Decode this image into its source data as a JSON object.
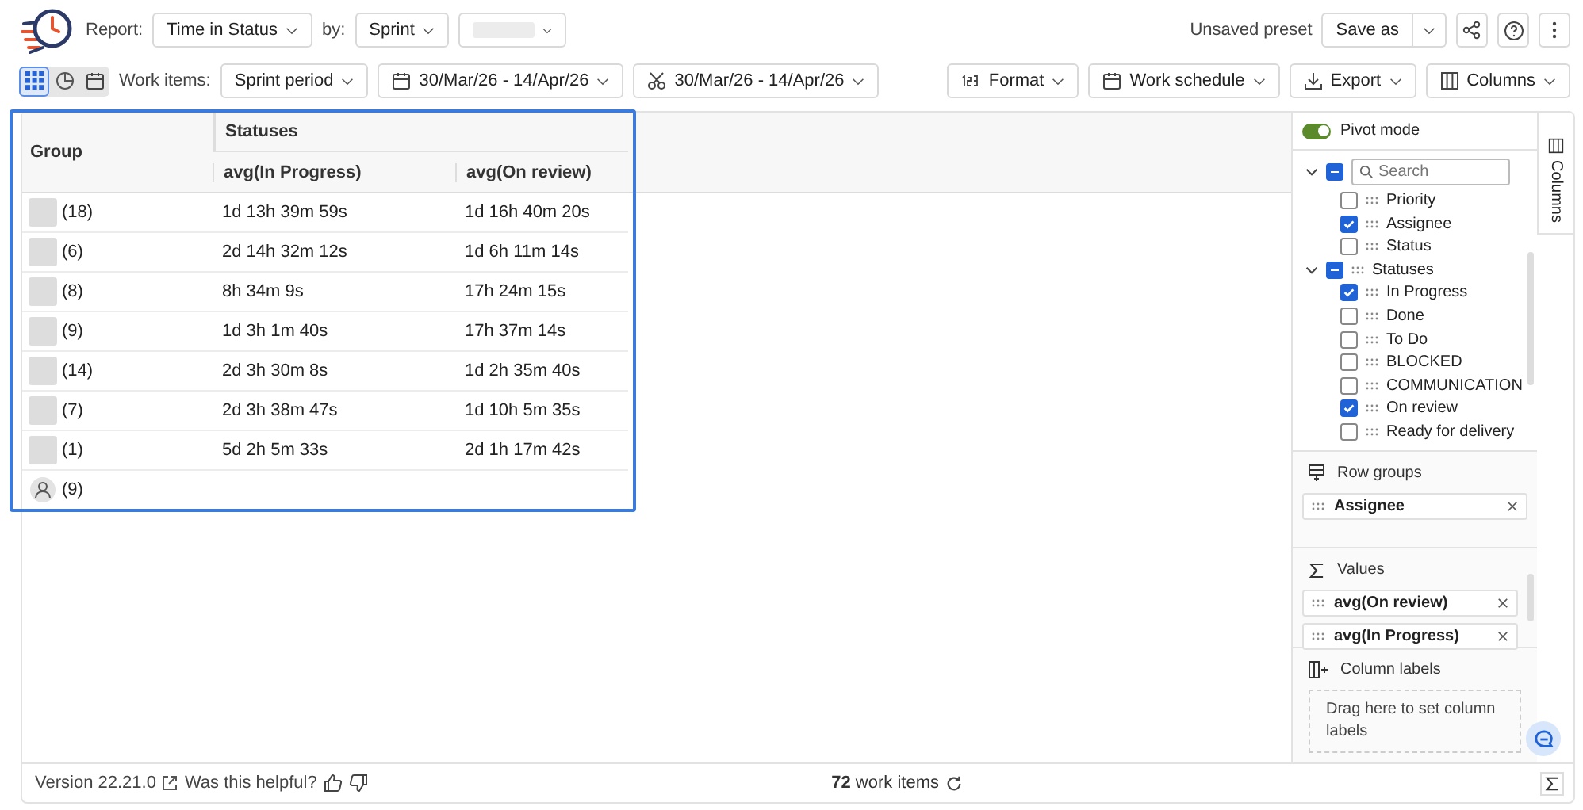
{
  "header": {
    "report_label": "Report:",
    "report": "Time in Status",
    "by_label": "by:",
    "by": "Sprint",
    "preset_status": "Unsaved preset",
    "save_button": "Save as"
  },
  "toolbar": {
    "views": [
      {
        "kind": "grid",
        "selected": true
      },
      {
        "kind": "pie",
        "selected": false
      },
      {
        "kind": "calendar",
        "selected": false
      }
    ],
    "work_items_label": "Work items:",
    "period": "Sprint period",
    "date_range": "30/Mar/26 - 14/Apr/26",
    "cut_range": "30/Mar/26 - 14/Apr/26",
    "actions": [
      {
        "kind": "format",
        "label": "Format"
      },
      {
        "kind": "schedule",
        "label": "Work schedule"
      },
      {
        "kind": "export",
        "label": "Export"
      },
      {
        "kind": "columns",
        "label": "Columns"
      }
    ]
  },
  "table": {
    "group_header": "Group",
    "band_header": "Statuses",
    "columns": [
      "avg(In Progress)",
      "avg(On review)"
    ],
    "rows": [
      {
        "kind": "photo",
        "count": "(18)",
        "values": [
          "1d 13h 39m 59s",
          "1d 16h 40m 20s"
        ]
      },
      {
        "kind": "photo",
        "count": "(6)",
        "values": [
          "2d 14h 32m 12s",
          "1d 6h 11m 14s"
        ]
      },
      {
        "kind": "photo",
        "count": "(8)",
        "values": [
          "8h 34m 9s",
          "17h 24m 15s"
        ]
      },
      {
        "kind": "photo",
        "count": "(9)",
        "values": [
          "1d 3h 1m 40s",
          "17h 37m 14s"
        ]
      },
      {
        "kind": "photo",
        "count": "(14)",
        "values": [
          "2d 3h 30m 8s",
          "1d 2h 35m 40s"
        ]
      },
      {
        "kind": "photo",
        "count": "(7)",
        "values": [
          "2d 3h 38m 47s",
          "1d 10h 5m 35s"
        ]
      },
      {
        "kind": "photo",
        "count": "(1)",
        "values": [
          "5d 2h 5m 33s",
          "2d 1h 17m 42s"
        ]
      },
      {
        "kind": "generic",
        "count": "(9)"
      }
    ]
  },
  "side_panel": {
    "pivot_mode": {
      "label": "Pivot mode",
      "on": true
    },
    "search": {
      "placeholder": "Search"
    },
    "groups": [
      {
        "expanded": true,
        "indeterminate": true,
        "children": [
          {
            "label": "Priority",
            "checked": false
          },
          {
            "label": "Assignee",
            "checked": true
          },
          {
            "label": "Status",
            "checked": false
          }
        ]
      },
      {
        "label": "Statuses",
        "expanded": true,
        "indeterminate": true,
        "children": [
          {
            "label": "In Progress",
            "checked": true
          },
          {
            "label": "Done",
            "checked": false
          },
          {
            "label": "To Do",
            "checked": false
          },
          {
            "label": "BLOCKED",
            "checked": false
          },
          {
            "label": "COMMUNICATION",
            "checked": false
          },
          {
            "label": "On review",
            "checked": true
          },
          {
            "label": "Ready for delivery",
            "checked": false
          }
        ]
      }
    ],
    "row_groups": {
      "title": "Row groups",
      "items": [
        "Assignee"
      ]
    },
    "values": {
      "title": "Values",
      "items": [
        "avg(On review)",
        "avg(In Progress)"
      ]
    },
    "column_labels": {
      "title": "Column labels",
      "drop_hint": "Drag here to set column labels"
    },
    "tab": "Columns"
  },
  "footer": {
    "version": "Version 22.21.0",
    "feedback": "Was this helpful?",
    "count": "**72** work items"
  }
}
